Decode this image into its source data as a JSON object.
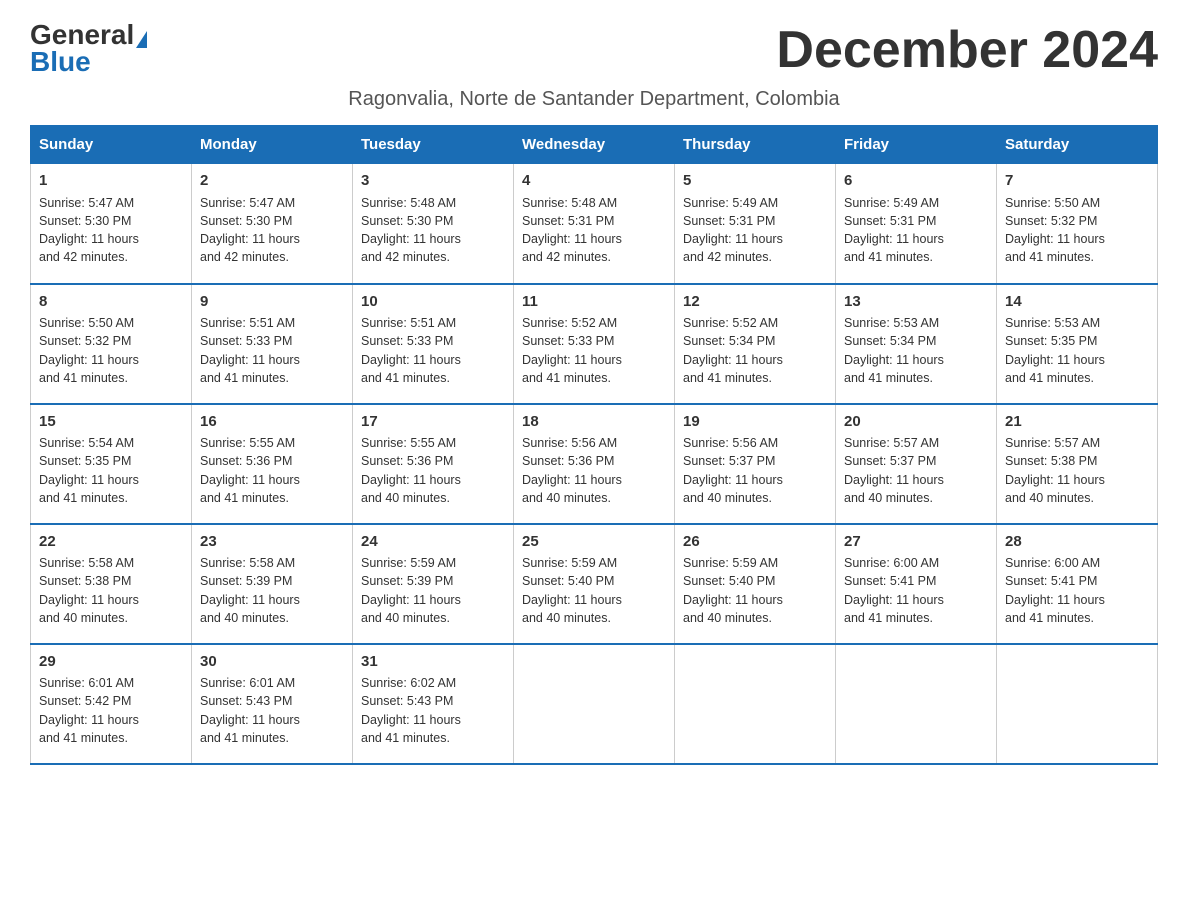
{
  "header": {
    "logo_general": "General",
    "logo_blue": "Blue",
    "month_title": "December 2024",
    "subtitle": "Ragonvalia, Norte de Santander Department, Colombia"
  },
  "days_of_week": [
    "Sunday",
    "Monday",
    "Tuesday",
    "Wednesday",
    "Thursday",
    "Friday",
    "Saturday"
  ],
  "weeks": [
    [
      {
        "day": "1",
        "sunrise": "5:47 AM",
        "sunset": "5:30 PM",
        "daylight": "11 hours and 42 minutes."
      },
      {
        "day": "2",
        "sunrise": "5:47 AM",
        "sunset": "5:30 PM",
        "daylight": "11 hours and 42 minutes."
      },
      {
        "day": "3",
        "sunrise": "5:48 AM",
        "sunset": "5:30 PM",
        "daylight": "11 hours and 42 minutes."
      },
      {
        "day": "4",
        "sunrise": "5:48 AM",
        "sunset": "5:31 PM",
        "daylight": "11 hours and 42 minutes."
      },
      {
        "day": "5",
        "sunrise": "5:49 AM",
        "sunset": "5:31 PM",
        "daylight": "11 hours and 42 minutes."
      },
      {
        "day": "6",
        "sunrise": "5:49 AM",
        "sunset": "5:31 PM",
        "daylight": "11 hours and 41 minutes."
      },
      {
        "day": "7",
        "sunrise": "5:50 AM",
        "sunset": "5:32 PM",
        "daylight": "11 hours and 41 minutes."
      }
    ],
    [
      {
        "day": "8",
        "sunrise": "5:50 AM",
        "sunset": "5:32 PM",
        "daylight": "11 hours and 41 minutes."
      },
      {
        "day": "9",
        "sunrise": "5:51 AM",
        "sunset": "5:33 PM",
        "daylight": "11 hours and 41 minutes."
      },
      {
        "day": "10",
        "sunrise": "5:51 AM",
        "sunset": "5:33 PM",
        "daylight": "11 hours and 41 minutes."
      },
      {
        "day": "11",
        "sunrise": "5:52 AM",
        "sunset": "5:33 PM",
        "daylight": "11 hours and 41 minutes."
      },
      {
        "day": "12",
        "sunrise": "5:52 AM",
        "sunset": "5:34 PM",
        "daylight": "11 hours and 41 minutes."
      },
      {
        "day": "13",
        "sunrise": "5:53 AM",
        "sunset": "5:34 PM",
        "daylight": "11 hours and 41 minutes."
      },
      {
        "day": "14",
        "sunrise": "5:53 AM",
        "sunset": "5:35 PM",
        "daylight": "11 hours and 41 minutes."
      }
    ],
    [
      {
        "day": "15",
        "sunrise": "5:54 AM",
        "sunset": "5:35 PM",
        "daylight": "11 hours and 41 minutes."
      },
      {
        "day": "16",
        "sunrise": "5:55 AM",
        "sunset": "5:36 PM",
        "daylight": "11 hours and 41 minutes."
      },
      {
        "day": "17",
        "sunrise": "5:55 AM",
        "sunset": "5:36 PM",
        "daylight": "11 hours and 40 minutes."
      },
      {
        "day": "18",
        "sunrise": "5:56 AM",
        "sunset": "5:36 PM",
        "daylight": "11 hours and 40 minutes."
      },
      {
        "day": "19",
        "sunrise": "5:56 AM",
        "sunset": "5:37 PM",
        "daylight": "11 hours and 40 minutes."
      },
      {
        "day": "20",
        "sunrise": "5:57 AM",
        "sunset": "5:37 PM",
        "daylight": "11 hours and 40 minutes."
      },
      {
        "day": "21",
        "sunrise": "5:57 AM",
        "sunset": "5:38 PM",
        "daylight": "11 hours and 40 minutes."
      }
    ],
    [
      {
        "day": "22",
        "sunrise": "5:58 AM",
        "sunset": "5:38 PM",
        "daylight": "11 hours and 40 minutes."
      },
      {
        "day": "23",
        "sunrise": "5:58 AM",
        "sunset": "5:39 PM",
        "daylight": "11 hours and 40 minutes."
      },
      {
        "day": "24",
        "sunrise": "5:59 AM",
        "sunset": "5:39 PM",
        "daylight": "11 hours and 40 minutes."
      },
      {
        "day": "25",
        "sunrise": "5:59 AM",
        "sunset": "5:40 PM",
        "daylight": "11 hours and 40 minutes."
      },
      {
        "day": "26",
        "sunrise": "5:59 AM",
        "sunset": "5:40 PM",
        "daylight": "11 hours and 40 minutes."
      },
      {
        "day": "27",
        "sunrise": "6:00 AM",
        "sunset": "5:41 PM",
        "daylight": "11 hours and 41 minutes."
      },
      {
        "day": "28",
        "sunrise": "6:00 AM",
        "sunset": "5:41 PM",
        "daylight": "11 hours and 41 minutes."
      }
    ],
    [
      {
        "day": "29",
        "sunrise": "6:01 AM",
        "sunset": "5:42 PM",
        "daylight": "11 hours and 41 minutes."
      },
      {
        "day": "30",
        "sunrise": "6:01 AM",
        "sunset": "5:43 PM",
        "daylight": "11 hours and 41 minutes."
      },
      {
        "day": "31",
        "sunrise": "6:02 AM",
        "sunset": "5:43 PM",
        "daylight": "11 hours and 41 minutes."
      },
      null,
      null,
      null,
      null
    ]
  ],
  "labels": {
    "sunrise": "Sunrise:",
    "sunset": "Sunset:",
    "daylight": "Daylight:"
  }
}
